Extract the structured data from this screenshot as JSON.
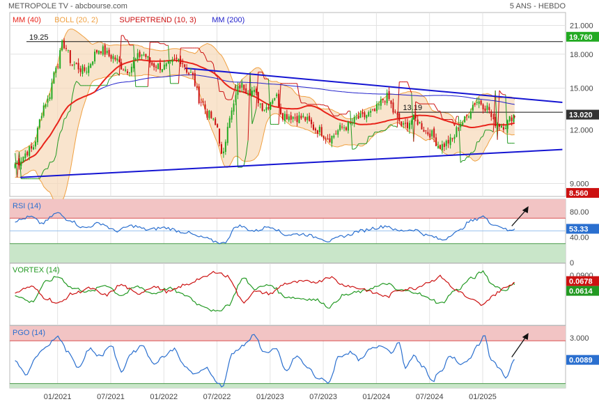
{
  "header": {
    "title": "METROPOLE TV - abcbourse.com",
    "period": "5 ANS - HEBDO"
  },
  "x_ticks": [
    "01/2021",
    "07/2021",
    "01/2022",
    "07/2022",
    "01/2023",
    "07/2023",
    "01/2024",
    "07/2024",
    "01/2025"
  ],
  "colors": {
    "candle_up": "#22aa22",
    "candle_down": "#cc1111",
    "mm40": "#e8231a",
    "mm200": "#2222cc",
    "boll": "#f0a040",
    "supertrend_up": "#229922",
    "supertrend_down": "#cc1111",
    "trendline": "#1414d2",
    "rsi": "#2a6fcf",
    "vortex_plus": "#229922",
    "vortex_minus": "#cc1111",
    "pgo": "#2a6fcf",
    "zone_high": "#f2c4c4",
    "zone_low": "#c9e6c9"
  },
  "chart_data": [
    {
      "type": "candlestick",
      "name": "price",
      "legend": [
        {
          "label": "MM (40)",
          "color": "#e8231a"
        },
        {
          "label": "BOLL (20, 2)",
          "color": "#f0a040"
        },
        {
          "label": "SUPERTREND (10, 3)",
          "color": "#cc1111"
        },
        {
          "label": "MM (200)",
          "color": "#2222cc"
        }
      ],
      "y_scale": "log",
      "ylim": [
        8.4,
        22.5
      ],
      "y_ticks": [
        "9.000",
        "12.000",
        "15.000",
        "18.000",
        "21.000"
      ],
      "y_tick_values": [
        9,
        12,
        15,
        18,
        21
      ],
      "x_range": [
        2020.55,
        2025.78
      ],
      "anchors": [
        [
          2020.6,
          10.0
        ],
        [
          2020.75,
          10.8
        ],
        [
          2020.9,
          14.0
        ],
        [
          2021.0,
          17.2
        ],
        [
          2021.05,
          19.0
        ],
        [
          2021.15,
          17.0
        ],
        [
          2021.25,
          16.5
        ],
        [
          2021.4,
          18.5
        ],
        [
          2021.5,
          17.8
        ],
        [
          2021.65,
          16.6
        ],
        [
          2021.8,
          18.0
        ],
        [
          2021.9,
          17.0
        ],
        [
          2022.0,
          16.8
        ],
        [
          2022.15,
          17.5
        ],
        [
          2022.25,
          16.2
        ],
        [
          2022.35,
          14.0
        ],
        [
          2022.42,
          13.0
        ],
        [
          2022.5,
          12.2
        ],
        [
          2022.55,
          10.3
        ],
        [
          2022.62,
          13.0
        ],
        [
          2022.72,
          15.2
        ],
        [
          2022.82,
          14.8
        ],
        [
          2022.95,
          13.5
        ],
        [
          2023.05,
          14.4
        ],
        [
          2023.12,
          13.0
        ],
        [
          2023.3,
          12.8
        ],
        [
          2023.45,
          12.0
        ],
        [
          2023.55,
          11.5
        ],
        [
          2023.7,
          12.2
        ],
        [
          2023.85,
          12.8
        ],
        [
          2023.95,
          13.1
        ],
        [
          2024.1,
          14.3
        ],
        [
          2024.18,
          13.0
        ],
        [
          2024.25,
          12.2
        ],
        [
          2024.35,
          12.7
        ],
        [
          2024.5,
          11.8
        ],
        [
          2024.6,
          11.0
        ],
        [
          2024.7,
          11.3
        ],
        [
          2024.8,
          12.5
        ],
        [
          2024.95,
          14.0
        ],
        [
          2025.05,
          13.5
        ],
        [
          2025.1,
          12.5
        ],
        [
          2025.2,
          12.3
        ],
        [
          2025.3,
          13.0
        ]
      ],
      "levels": [
        {
          "label": "19.25",
          "value": 19.25
        },
        {
          "label": "13.19",
          "value": 13.19
        }
      ],
      "price_tags": [
        {
          "label": "19.760",
          "value": 19.76,
          "color": "#22aa22"
        },
        {
          "label": "13.020",
          "value": 13.02,
          "color": "#333333"
        },
        {
          "label": "8.560",
          "value": 8.56,
          "color": "#cc1111"
        }
      ],
      "trendlines": [
        {
          "points": [
            [
              2020.65,
              9.3
            ],
            [
              2025.75,
              10.8
            ]
          ]
        },
        {
          "points": [
            [
              2022.2,
              16.7
            ],
            [
              2025.75,
              13.9
            ]
          ]
        }
      ]
    },
    {
      "type": "line",
      "name": "rsi",
      "label": "RSI (14)",
      "ylim": [
        0,
        100
      ],
      "y_ticks": [
        "0",
        "40.00",
        "80.00"
      ],
      "y_tick_values": [
        0,
        40,
        80
      ],
      "zones": {
        "high": 70,
        "low": 30,
        "mid": 50
      },
      "anchors": [
        [
          2020.6,
          66
        ],
        [
          2020.75,
          72
        ],
        [
          2020.85,
          62
        ],
        [
          2021.0,
          78
        ],
        [
          2021.1,
          68
        ],
        [
          2021.25,
          55
        ],
        [
          2021.4,
          62
        ],
        [
          2021.55,
          50
        ],
        [
          2021.7,
          58
        ],
        [
          2021.85,
          52
        ],
        [
          2022.0,
          55
        ],
        [
          2022.2,
          48
        ],
        [
          2022.35,
          40
        ],
        [
          2022.5,
          33
        ],
        [
          2022.55,
          30
        ],
        [
          2022.7,
          58
        ],
        [
          2022.85,
          50
        ],
        [
          2023.0,
          57
        ],
        [
          2023.15,
          44
        ],
        [
          2023.3,
          45
        ],
        [
          2023.45,
          40
        ],
        [
          2023.55,
          34
        ],
        [
          2023.7,
          42
        ],
        [
          2023.85,
          50
        ],
        [
          2024.0,
          55
        ],
        [
          2024.1,
          58
        ],
        [
          2024.2,
          50
        ],
        [
          2024.35,
          52
        ],
        [
          2024.5,
          42
        ],
        [
          2024.62,
          36
        ],
        [
          2024.75,
          48
        ],
        [
          2024.9,
          66
        ],
        [
          2025.0,
          73
        ],
        [
          2025.08,
          62
        ],
        [
          2025.15,
          58
        ],
        [
          2025.25,
          50
        ],
        [
          2025.3,
          53.33
        ]
      ],
      "last_value_label": "53.33",
      "arrow": true
    },
    {
      "type": "line",
      "name": "vortex",
      "label": "VORTEX (14)",
      "ylim": [
        -0.06,
        0.125
      ],
      "y_ticks": [
        "0.0900"
      ],
      "y_tick_values": [
        0.09
      ],
      "series": [
        {
          "name": "VI+",
          "color": "#229922",
          "anchors": [
            [
              2020.6,
              0.03
            ],
            [
              2020.75,
              0.01
            ],
            [
              2020.9,
              0.07
            ],
            [
              2021.0,
              0.085
            ],
            [
              2021.15,
              0.05
            ],
            [
              2021.3,
              0.04
            ],
            [
              2021.45,
              0.06
            ],
            [
              2021.6,
              0.03
            ],
            [
              2021.75,
              0.055
            ],
            [
              2021.9,
              0.035
            ],
            [
              2022.05,
              0.05
            ],
            [
              2022.2,
              0.03
            ],
            [
              2022.35,
              0.0
            ],
            [
              2022.5,
              -0.02
            ],
            [
              2022.6,
              0.0
            ],
            [
              2022.75,
              0.08
            ],
            [
              2022.85,
              0.05
            ],
            [
              2023.0,
              0.06
            ],
            [
              2023.15,
              0.025
            ],
            [
              2023.3,
              0.02
            ],
            [
              2023.45,
              0.015
            ],
            [
              2023.55,
              -0.005
            ],
            [
              2023.7,
              0.03
            ],
            [
              2023.85,
              0.04
            ],
            [
              2024.0,
              0.055
            ],
            [
              2024.1,
              0.065
            ],
            [
              2024.2,
              0.045
            ],
            [
              2024.35,
              0.04
            ],
            [
              2024.5,
              0.02
            ],
            [
              2024.6,
              0.005
            ],
            [
              2024.75,
              0.045
            ],
            [
              2024.9,
              0.08
            ],
            [
              2025.0,
              0.1
            ],
            [
              2025.1,
              0.06
            ],
            [
              2025.2,
              0.045
            ],
            [
              2025.3,
              0.0614
            ]
          ]
        },
        {
          "name": "VI-",
          "color": "#cc1111",
          "anchors": [
            [
              2020.6,
              0.04
            ],
            [
              2020.75,
              0.055
            ],
            [
              2020.9,
              0.02
            ],
            [
              2021.0,
              0.005
            ],
            [
              2021.15,
              0.035
            ],
            [
              2021.3,
              0.05
            ],
            [
              2021.45,
              0.03
            ],
            [
              2021.6,
              0.06
            ],
            [
              2021.75,
              0.035
            ],
            [
              2021.9,
              0.055
            ],
            [
              2022.05,
              0.04
            ],
            [
              2022.2,
              0.06
            ],
            [
              2022.35,
              0.08
            ],
            [
              2022.5,
              0.1
            ],
            [
              2022.6,
              0.085
            ],
            [
              2022.75,
              0.01
            ],
            [
              2022.85,
              0.04
            ],
            [
              2023.0,
              0.035
            ],
            [
              2023.15,
              0.065
            ],
            [
              2023.3,
              0.07
            ],
            [
              2023.45,
              0.07
            ],
            [
              2023.55,
              0.085
            ],
            [
              2023.7,
              0.06
            ],
            [
              2023.85,
              0.05
            ],
            [
              2024.0,
              0.035
            ],
            [
              2024.1,
              0.025
            ],
            [
              2024.2,
              0.045
            ],
            [
              2024.35,
              0.05
            ],
            [
              2024.5,
              0.07
            ],
            [
              2024.6,
              0.085
            ],
            [
              2024.75,
              0.045
            ],
            [
              2024.9,
              0.015
            ],
            [
              2025.0,
              0.0
            ],
            [
              2025.1,
              0.03
            ],
            [
              2025.2,
              0.05
            ],
            [
              2025.3,
              0.0678
            ]
          ]
        }
      ],
      "last_value_labels": [
        {
          "label": "0.0678",
          "color": "#cc1111"
        },
        {
          "label": "0.0614",
          "color": "#229922"
        }
      ]
    },
    {
      "type": "line",
      "name": "pgo",
      "label": "PGO (14)",
      "ylim": [
        -3.8,
        4.6
      ],
      "y_ticks": [
        "3.000"
      ],
      "y_tick_values": [
        3
      ],
      "zones": {
        "high": 2.6,
        "low": -3.2
      },
      "anchors": [
        [
          2020.6,
          0.0
        ],
        [
          2020.7,
          -2.0
        ],
        [
          2020.8,
          0.5
        ],
        [
          2020.9,
          2.0
        ],
        [
          2021.0,
          3.2
        ],
        [
          2021.1,
          1.0
        ],
        [
          2021.2,
          -1.0
        ],
        [
          2021.3,
          1.5
        ],
        [
          2021.4,
          0.5
        ],
        [
          2021.5,
          2.0
        ],
        [
          2021.6,
          -1.5
        ],
        [
          2021.7,
          1.0
        ],
        [
          2021.8,
          2.0
        ],
        [
          2021.9,
          -0.5
        ],
        [
          2022.0,
          0.5
        ],
        [
          2022.1,
          1.5
        ],
        [
          2022.2,
          -1.0
        ],
        [
          2022.3,
          -2.0
        ],
        [
          2022.4,
          -1.0
        ],
        [
          2022.5,
          -3.0
        ],
        [
          2022.55,
          -3.6
        ],
        [
          2022.65,
          1.0
        ],
        [
          2022.75,
          2.0
        ],
        [
          2022.85,
          3.3
        ],
        [
          2022.95,
          1.0
        ],
        [
          2023.05,
          1.5
        ],
        [
          2023.15,
          -1.5
        ],
        [
          2023.25,
          0.5
        ],
        [
          2023.35,
          -1.0
        ],
        [
          2023.45,
          -2.5
        ],
        [
          2023.55,
          -3.0
        ],
        [
          2023.65,
          0.5
        ],
        [
          2023.75,
          1.0
        ],
        [
          2023.85,
          0.0
        ],
        [
          2023.95,
          1.5
        ],
        [
          2024.05,
          2.0
        ],
        [
          2024.15,
          1.0
        ],
        [
          2024.2,
          2.5
        ],
        [
          2024.28,
          -1.0
        ],
        [
          2024.35,
          0.5
        ],
        [
          2024.45,
          -1.0
        ],
        [
          2024.52,
          -3.0
        ],
        [
          2024.6,
          -1.5
        ],
        [
          2024.7,
          0.5
        ],
        [
          2024.8,
          -0.5
        ],
        [
          2024.88,
          0.0
        ],
        [
          2024.95,
          2.0
        ],
        [
          2025.02,
          3.3
        ],
        [
          2025.08,
          0.0
        ],
        [
          2025.15,
          -1.0
        ],
        [
          2025.22,
          -2.5
        ],
        [
          2025.3,
          0.0089
        ]
      ],
      "last_value_label": "0.0089",
      "arrow": true
    }
  ]
}
